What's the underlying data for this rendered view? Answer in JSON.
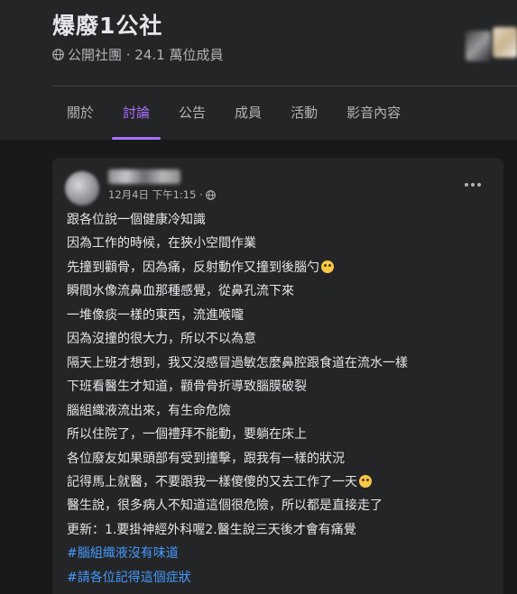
{
  "group": {
    "title": "爆廢1公社",
    "meta": "公開社團 · 24.1 萬位成員"
  },
  "tabs": [
    {
      "label": "關於"
    },
    {
      "label": "討論"
    },
    {
      "label": "公告"
    },
    {
      "label": "成員"
    },
    {
      "label": "活動"
    },
    {
      "label": "影音內容"
    }
  ],
  "active_tab": "討論",
  "post": {
    "time": "12月4日 下午1:15 ·",
    "lines": [
      "跟各位說一個健康冷知識",
      "因為工作的時候，在狹小空間作業",
      "先撞到顴骨，因為痛，反射動作又撞到後腦勺",
      "瞬間水像流鼻血那種感覺，從鼻孔流下來",
      "一堆像痰一樣的東西，流進喉嚨",
      "因為沒撞的很大力，所以不以為意",
      "隔天上班才想到，我又沒感冒過敏怎麼鼻腔跟食道在流水一樣",
      "下班看醫生才知道，顴骨骨折導致腦膜破裂",
      "腦組織液流出來，有生命危險",
      "所以住院了，一個禮拜不能動，要躺在床上",
      "各位廢友如果頭部有受到撞擊，跟我有一樣的狀況",
      "記得馬上就醫，不要跟我一樣傻傻的又去工作了一天",
      "醫生說，很多病人不知道這個很危險，所以都是直接走了",
      "更新：1.要掛神經外科喔2.醫生說三天後才會有痛覺"
    ],
    "hashtags": [
      "#腦組織液沒有味道",
      "#請各位記得這個症狀"
    ]
  },
  "colors": {
    "accent": "#a970ff",
    "hashtag": "#4599ff",
    "background": "#18191a",
    "surface": "#242526"
  },
  "icons": {
    "globe": "globe-icon",
    "more": "more-options-icon",
    "emoji": "rolling-eyes-emoji-icon"
  }
}
